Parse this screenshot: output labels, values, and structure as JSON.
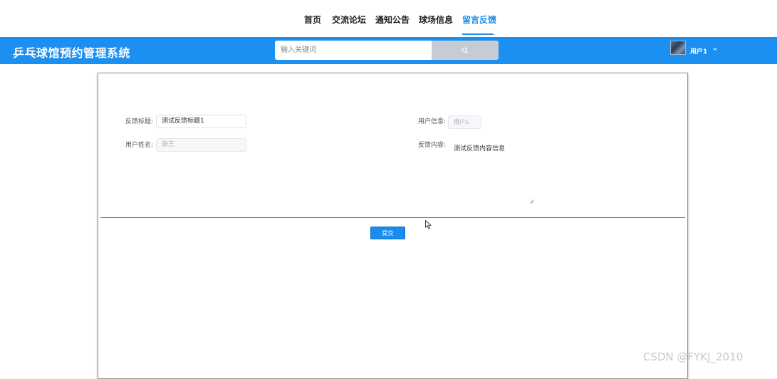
{
  "nav": {
    "items": [
      {
        "label": "首页"
      },
      {
        "label": "交流论坛"
      },
      {
        "label": "通知公告"
      },
      {
        "label": "球场信息"
      },
      {
        "label": "留言反馈"
      }
    ],
    "active_index": 4
  },
  "header": {
    "brand": "乒乓球馆预约管理系统",
    "search_placeholder": "输入关键词",
    "search_icon": "search-icon",
    "user_name": "用户1"
  },
  "form": {
    "title_label": "反馈标题:",
    "title_value": "测试反馈标题1",
    "name_label": "用户姓名:",
    "name_value": "张三",
    "userinfo_label": "用户信息:",
    "userinfo_value": "用户1-",
    "content_label": "反馈内容:",
    "content_value": "测试反馈内容信息",
    "submit_label": "提交"
  },
  "watermark": "CSDN @FYKJ_2010",
  "colors": {
    "primary": "#1c90f0",
    "nav_active": "#1f8ee8",
    "search_button": "#c6ccd4"
  }
}
